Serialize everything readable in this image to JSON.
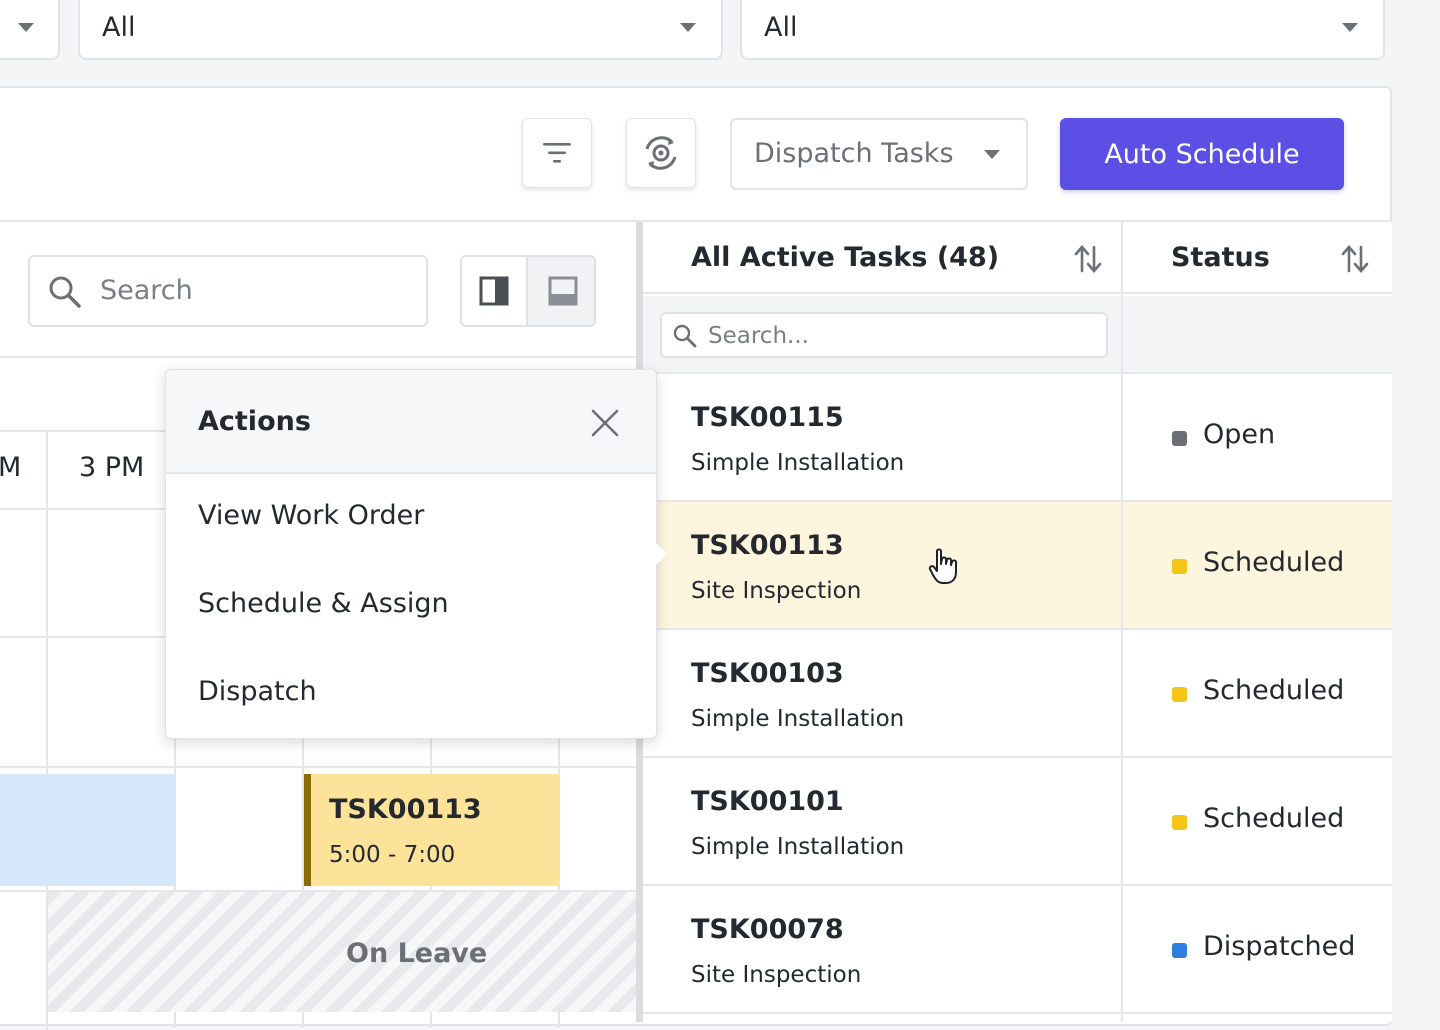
{
  "filters": [
    {
      "value": ""
    },
    {
      "value": "All"
    },
    {
      "value": "All"
    }
  ],
  "toolbar": {
    "filter_icon": "filter-icon",
    "settings_icon": "gear-sync-icon",
    "dispatch_select": "Dispatch Tasks",
    "auto_schedule": "Auto Schedule",
    "accent": "#5b4fe5"
  },
  "schedule": {
    "search_placeholder": "Search",
    "time_partial": "M",
    "time_3pm": "3 PM",
    "task_block": {
      "id": "TSK00113",
      "time": "5:00 - 7:00"
    },
    "leave_label": "On Leave"
  },
  "actions_popover": {
    "title": "Actions",
    "items": [
      "View Work Order",
      "Schedule & Assign",
      "Dispatch"
    ]
  },
  "task_list": {
    "header_tasks": "All Active Tasks (48)",
    "header_status": "Status",
    "search_placeholder": "Search...",
    "rows": [
      {
        "id": "TSK00115",
        "type": "Simple Installation",
        "status": "Open",
        "color": "#6b6f76"
      },
      {
        "id": "TSK00113",
        "type": "Site Inspection",
        "status": "Scheduled",
        "color": "#f5c518"
      },
      {
        "id": "TSK00103",
        "type": "Simple Installation",
        "status": "Scheduled",
        "color": "#f5c518"
      },
      {
        "id": "TSK00101",
        "type": "Simple Installation",
        "status": "Scheduled",
        "color": "#f5c518"
      },
      {
        "id": "TSK00078",
        "type": "Site Inspection",
        "status": "Dispatched",
        "color": "#2f7fe0"
      }
    ]
  }
}
